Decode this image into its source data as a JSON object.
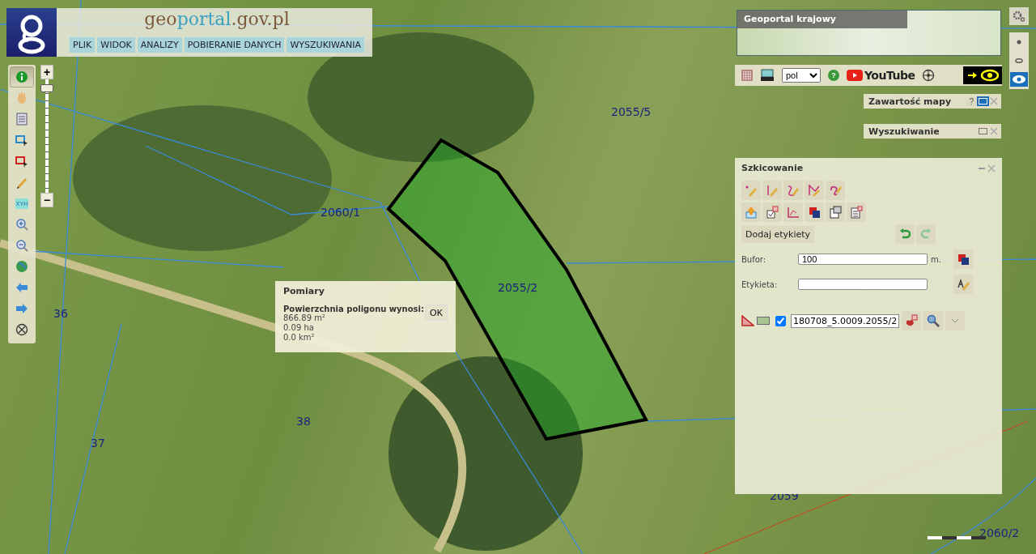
{
  "header": {
    "logo_parts": [
      "geo",
      "portal",
      ".gov.pl"
    ],
    "menu": [
      "PLIK",
      "WIDOK",
      "ANALIZY",
      "POBIERANIE DANYCH",
      "WYSZUKIWANIA"
    ]
  },
  "toolbar": {
    "tools": [
      {
        "kind": "info",
        "selected": true
      },
      {
        "kind": "pan",
        "selected": false
      },
      {
        "kind": "legend",
        "selected": false
      },
      {
        "kind": "select",
        "selected": false
      },
      {
        "kind": "select-red",
        "selected": false
      },
      {
        "kind": "pencil",
        "selected": false
      },
      {
        "kind": "xyh",
        "label": "XYH",
        "selected": false
      },
      {
        "kind": "zoom-in",
        "selected": false
      },
      {
        "kind": "zoom-out",
        "selected": false
      },
      {
        "kind": "globe",
        "selected": false
      },
      {
        "kind": "back",
        "selected": false
      },
      {
        "kind": "forward",
        "selected": false
      },
      {
        "kind": "compass",
        "selected": false
      }
    ]
  },
  "zoom": {
    "plus": "+",
    "minus": "−",
    "level": 0.92
  },
  "overview": {
    "title": "Geoportal krajowy"
  },
  "top_bar": {
    "language": "pol",
    "help": "?",
    "video": "YouTube"
  },
  "view_modes": [
    {
      "kind": "dot",
      "selected": false
    },
    {
      "kind": "eye-small",
      "selected": false
    },
    {
      "kind": "eye",
      "selected": true
    }
  ],
  "panels": [
    {
      "title": "Zawartość mapy",
      "help": "?"
    },
    {
      "title": "Wyszukiwanie"
    }
  ],
  "sketch": {
    "title": "Szkicowanie",
    "row1": [
      {
        "kind": "point"
      },
      {
        "kind": "line"
      },
      {
        "kind": "curve"
      },
      {
        "kind": "polygon"
      },
      {
        "kind": "freehand"
      }
    ],
    "row2": [
      {
        "kind": "import"
      },
      {
        "kind": "delete-check"
      },
      {
        "kind": "edit"
      },
      {
        "kind": "overlap"
      },
      {
        "kind": "copy"
      },
      {
        "kind": "clear"
      }
    ],
    "add_labels": "Dodaj etykiety",
    "buffer_label": "Bufor:",
    "buffer_value": "100",
    "buffer_unit": "m.",
    "label_label": "Etykieta:",
    "layer": {
      "checked": true,
      "name": "180708_5.0009.2055/2"
    }
  },
  "popup": {
    "title": "Pomiary",
    "heading": "Powierzchnia poligonu wynosi:",
    "lines": [
      "866.89 m²",
      "0.09 ha",
      "0.0 km²"
    ],
    "ok": "OK"
  },
  "parcels": [
    "2055/5",
    "2060/1",
    "2055/2",
    "36",
    "38",
    "37",
    "2059",
    "2060/2"
  ]
}
